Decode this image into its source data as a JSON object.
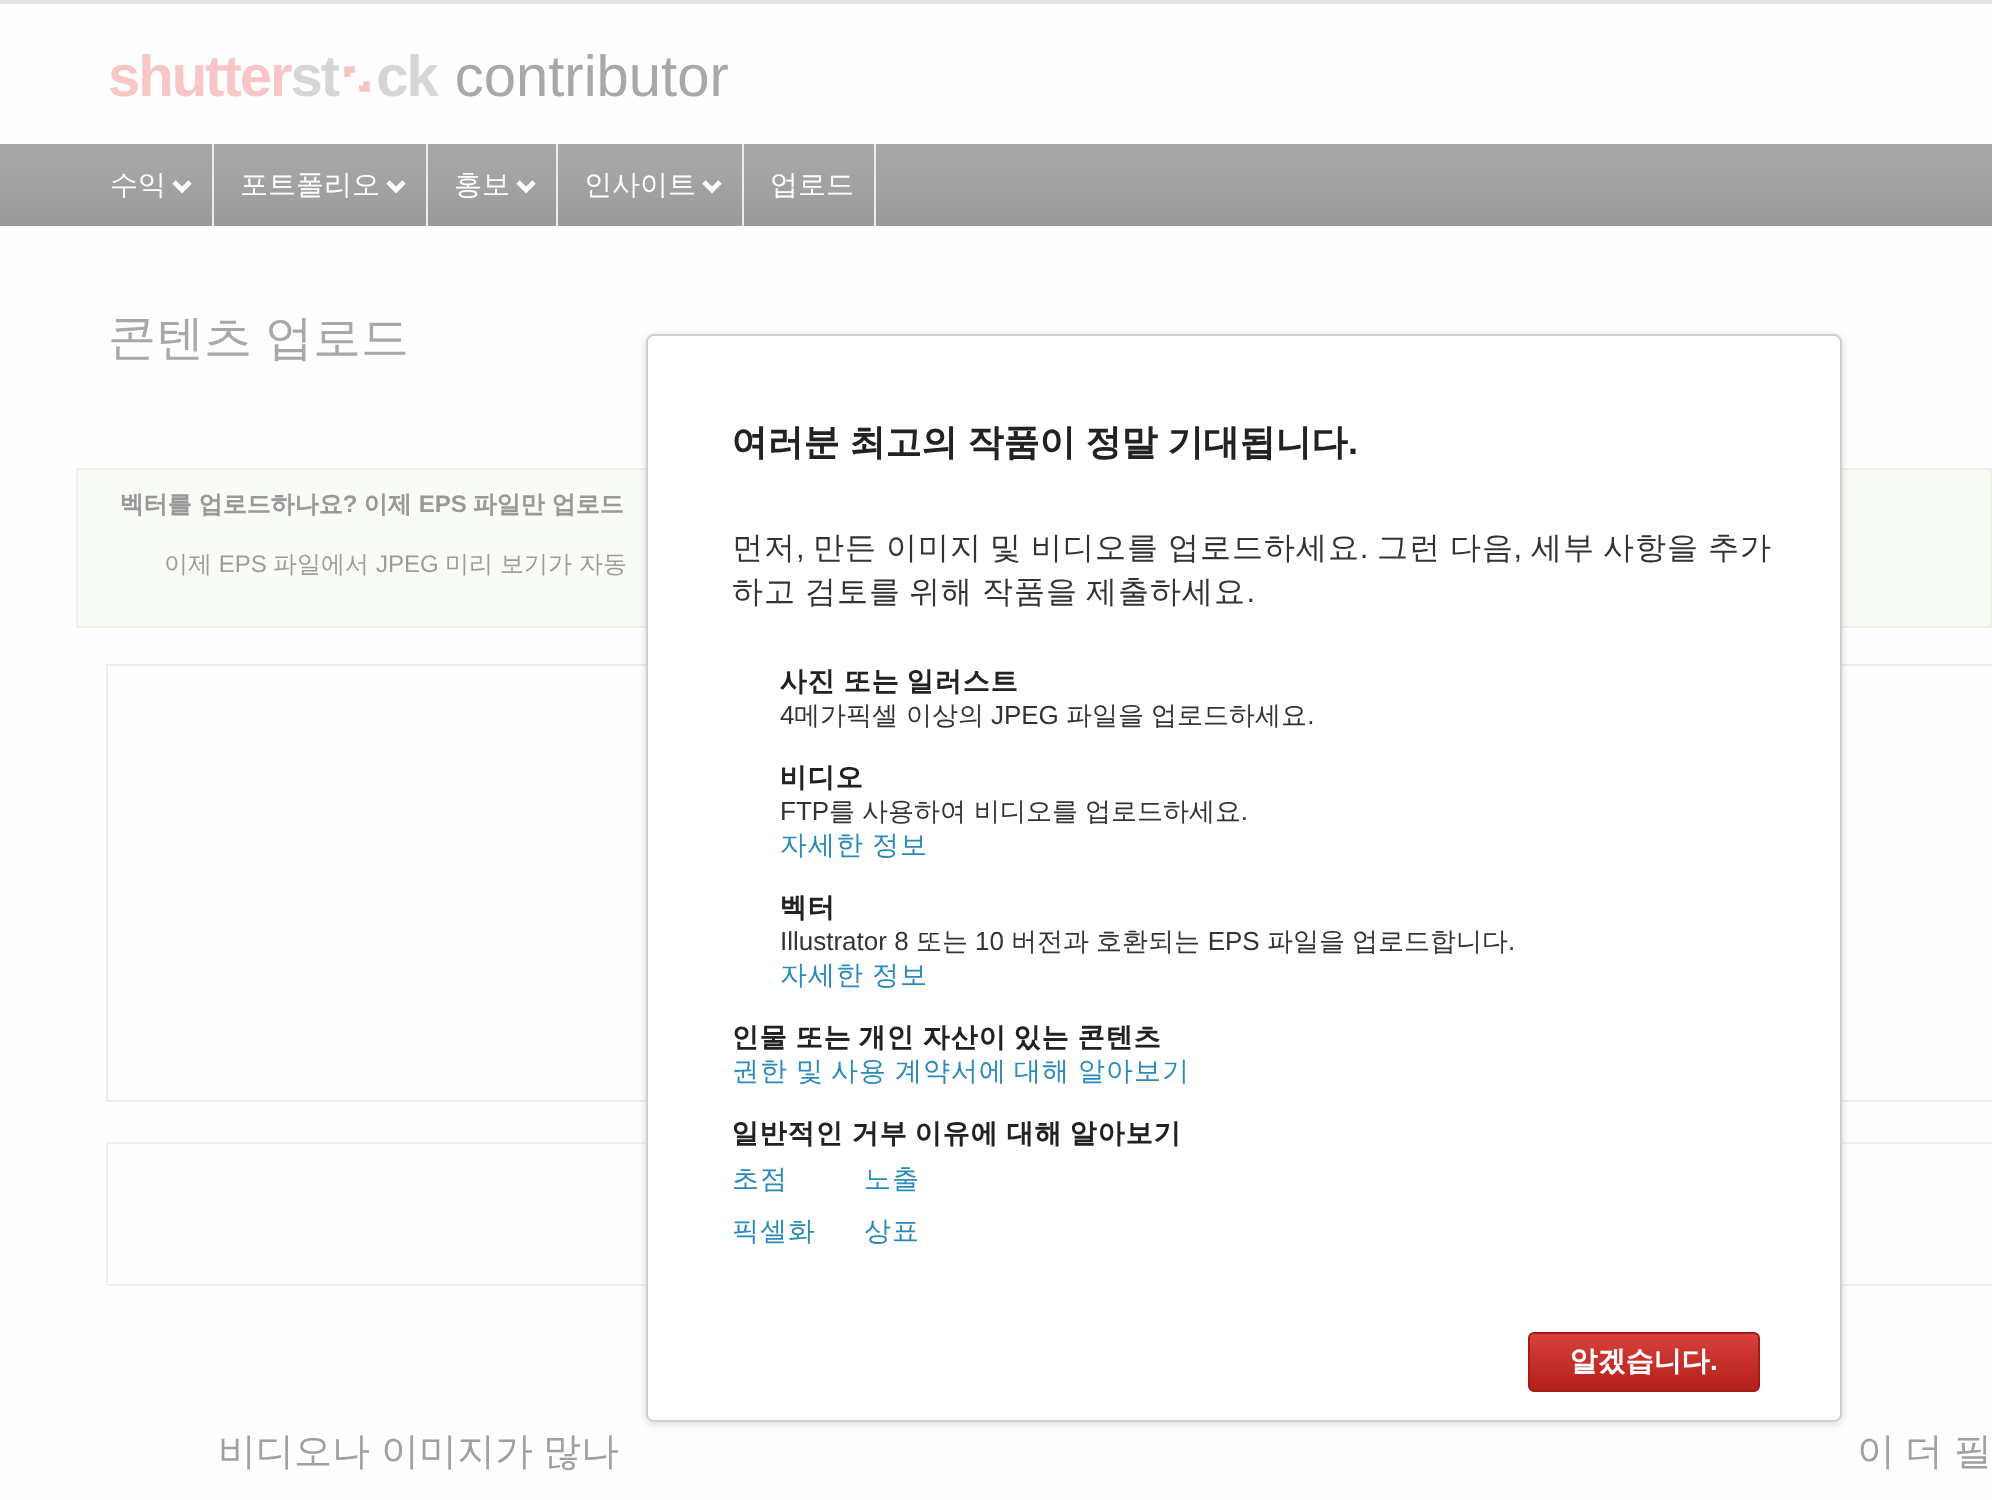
{
  "header": {
    "logo": {
      "brand_prefix": "shutter",
      "brand_middle": "st",
      "brand_suffix": "ck",
      "product": "contributor"
    }
  },
  "nav": [
    {
      "label": "수익",
      "has_menu": true
    },
    {
      "label": "포트폴리오",
      "has_menu": true
    },
    {
      "label": "홍보",
      "has_menu": true
    },
    {
      "label": "인사이트",
      "has_menu": true
    },
    {
      "label": "업로드",
      "has_menu": false
    }
  ],
  "page": {
    "title": "콘텐츠 업로드",
    "notice": {
      "heading": "벡터를 업로드하나요? 이제 EPS 파일만 업로드",
      "text": "이제 EPS 파일에서 JPEG 미리 보기가 자동"
    },
    "promo_left": "비디오나 이미지가 많나",
    "promo_right": "이 더 필"
  },
  "dialog": {
    "title": "여러분 최고의 작품이 정말 기대됩니다.",
    "intro": "먼저, 만든 이미지 및 비디오를 업로드하세요. 그런 다음, 세부 사항을 추가하고 검토를 위해 작품을 제출하세요.",
    "upload_types": [
      {
        "heading": "사진 또는 일러스트",
        "text": "4메가픽셀 이상의 JPEG 파일을 업로드하세요."
      },
      {
        "heading": "비디오",
        "text": "FTP를 사용하여 비디오를 업로드하세요.",
        "link": "자세한 정보"
      },
      {
        "heading": "벡터",
        "text": "Illustrator 8 또는 10 버전과 호환되는 EPS 파일을 업로드합니다.",
        "link": "자세한 정보"
      }
    ],
    "rights": {
      "heading": "인물 또는 개인 자산이 있는 콘텐츠",
      "link": "권한 및 사용 계약서에 대해 알아보기"
    },
    "rejection": {
      "heading": "일반적인 거부 이유에 대해 알아보기",
      "reasons": [
        "초점",
        "노출",
        "픽셀화",
        "상표"
      ]
    },
    "button": "알겠습니다."
  }
}
